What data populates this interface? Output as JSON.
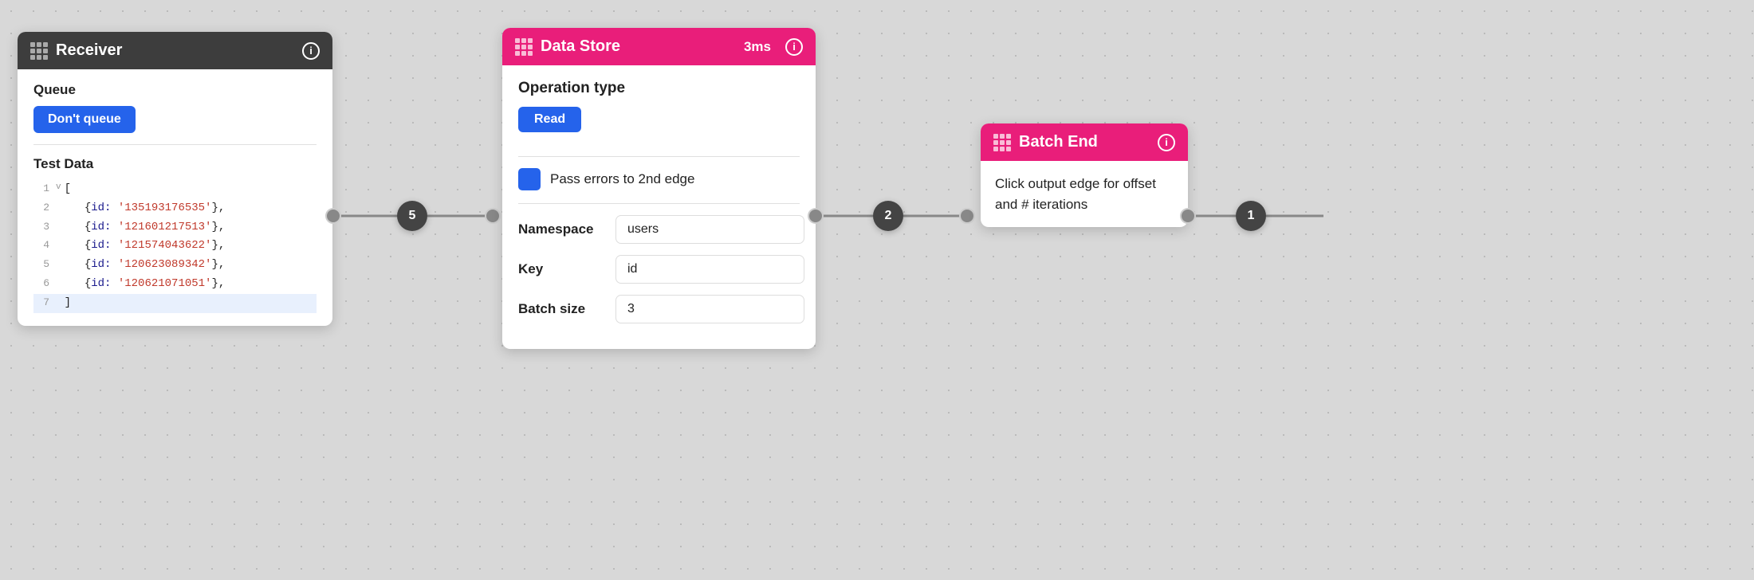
{
  "receiver": {
    "title": "Receiver",
    "queue_section": "Queue",
    "dont_queue_label": "Don't queue",
    "test_data_label": "Test Data",
    "code_lines": [
      {
        "num": "1",
        "arrow": "v",
        "content": "[",
        "highlight": false
      },
      {
        "num": "2",
        "arrow": "",
        "content": "{id:",
        "key": "id",
        "val": "'135193176535'",
        "suffix": "},",
        "highlight": false
      },
      {
        "num": "3",
        "arrow": "",
        "content": "{id:",
        "key": "id",
        "val": "'121601217513'",
        "suffix": "},",
        "highlight": false
      },
      {
        "num": "4",
        "arrow": "",
        "content": "{id:",
        "key": "id",
        "val": "'121574043622'",
        "suffix": "},",
        "highlight": false
      },
      {
        "num": "5",
        "arrow": "",
        "content": "{id:",
        "key": "id",
        "val": "'120623089342'",
        "suffix": "},",
        "highlight": false
      },
      {
        "num": "6",
        "arrow": "",
        "content": "{id:",
        "key": "id",
        "val": "'120621071051'",
        "suffix": "},",
        "highlight": false
      },
      {
        "num": "7",
        "arrow": "",
        "content": "]",
        "highlight": true
      }
    ]
  },
  "datastore": {
    "title": "Data Store",
    "timing": "3ms",
    "operation_type_label": "Operation type",
    "read_label": "Read",
    "pass_errors_label": "Pass errors to 2nd edge",
    "namespace_label": "Namespace",
    "namespace_value": "users",
    "key_label": "Key",
    "key_value": "id",
    "batch_size_label": "Batch size",
    "batch_size_value": "3"
  },
  "batch_end": {
    "title": "Batch End",
    "body_text": "Click output edge for offset and # iterations"
  },
  "connectors": {
    "circle_5": "5",
    "circle_2": "2",
    "circle_1": "1"
  }
}
